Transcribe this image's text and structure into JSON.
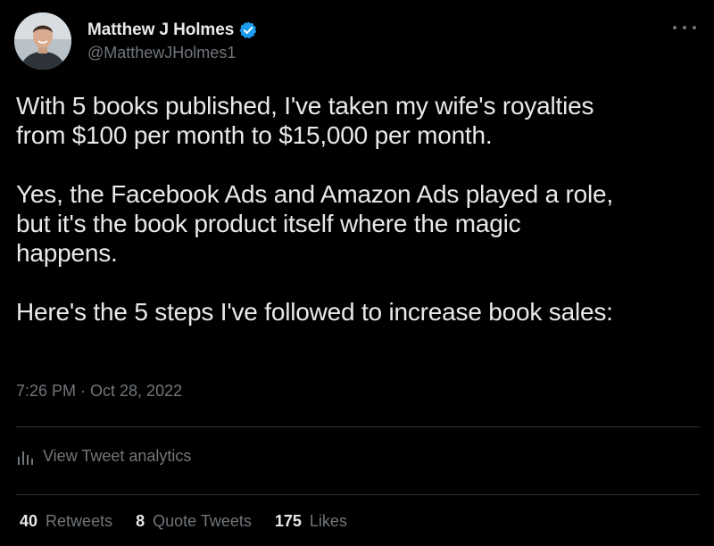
{
  "author": {
    "display_name": "Matthew J Holmes",
    "handle": "@MatthewJHolmes1",
    "verified_icon": "verified-badge-icon",
    "verified_color": "#1d9bf0"
  },
  "tweet": {
    "paragraphs": [
      "With 5 books published, I've taken my wife's royalties\nfrom $100 per month to $15,000 per month.",
      "Yes, the Facebook Ads and Amazon Ads played a role,\nbut it's the book product itself where the magic\nhappens.",
      "Here's the 5 steps I've followed to increase book sales:"
    ],
    "timestamp": "7:26 PM · Oct 28, 2022"
  },
  "analytics": {
    "icon": "analytics-bar-icon",
    "label": "View Tweet analytics"
  },
  "stats": {
    "retweets": {
      "count": "40",
      "label": "Retweets"
    },
    "quote_tweets": {
      "count": "8",
      "label": "Quote Tweets"
    },
    "likes": {
      "count": "175",
      "label": "Likes"
    }
  },
  "colors": {
    "background": "#000000",
    "text_primary": "#e7e9ea",
    "text_secondary": "#71767b",
    "divider": "#2f3336"
  }
}
